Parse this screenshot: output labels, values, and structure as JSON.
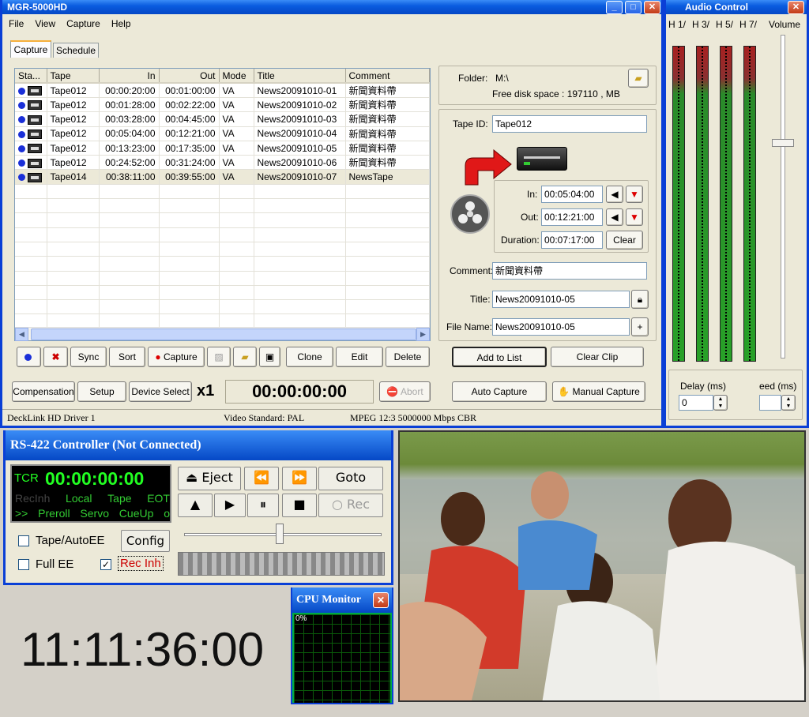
{
  "main_window": {
    "title": "MGR-5000HD",
    "menu": [
      "File",
      "View",
      "Capture",
      "Help"
    ],
    "tabs": [
      "Capture",
      "Schedule"
    ],
    "columns": [
      "Sta...",
      "Tape",
      "In",
      "Out",
      "Mode",
      "Title",
      "Comment"
    ],
    "rows": [
      {
        "tape": "Tape012",
        "in": "00:00:20:00",
        "out": "00:01:00:00",
        "mode": "VA",
        "title": "News20091010-01",
        "comment": "新聞資料帶"
      },
      {
        "tape": "Tape012",
        "in": "00:01:28:00",
        "out": "00:02:22:00",
        "mode": "VA",
        "title": "News20091010-02",
        "comment": "新聞資料帶"
      },
      {
        "tape": "Tape012",
        "in": "00:03:28:00",
        "out": "00:04:45:00",
        "mode": "VA",
        "title": "News20091010-03",
        "comment": "新聞資料帶"
      },
      {
        "tape": "Tape012",
        "in": "00:05:04:00",
        "out": "00:12:21:00",
        "mode": "VA",
        "title": "News20091010-04",
        "comment": "新聞資料帶"
      },
      {
        "tape": "Tape012",
        "in": "00:13:23:00",
        "out": "00:17:35:00",
        "mode": "VA",
        "title": "News20091010-05",
        "comment": "新聞資料帶"
      },
      {
        "tape": "Tape012",
        "in": "00:24:52:00",
        "out": "00:31:24:00",
        "mode": "VA",
        "title": "News20091010-06",
        "comment": "新聞資料帶"
      },
      {
        "tape": "Tape014",
        "in": "00:38:11:00",
        "out": "00:39:55:00",
        "mode": "VA",
        "title": "News20091010-07",
        "comment": "NewsTape"
      }
    ],
    "toolbar": {
      "sync": "Sync",
      "sort": "Sort",
      "capture": "Capture",
      "clone": "Clone",
      "edit": "Edit",
      "delete": "Delete"
    },
    "bottom": {
      "compensation": "Compensation",
      "setup": "Setup",
      "device_select": "Device Select",
      "speed": "x1",
      "timecode": "00:00:00:00",
      "abort": "Abort",
      "auto_capture": "Auto Capture",
      "manual_capture": "Manual Capture"
    },
    "folder": {
      "label": "Folder:",
      "value": "M:\\",
      "free": "Free disk space : 197110 , MB"
    },
    "clip": {
      "tape_id_label": "Tape ID:",
      "tape_id": "Tape012",
      "in_label": "In:",
      "in": "00:05:04:00",
      "out_label": "Out:",
      "out": "00:12:21:00",
      "duration_label": "Duration:",
      "duration": "00:07:17:00",
      "clear": "Clear",
      "comment_label": "Comment:",
      "comment": "新聞資料帶",
      "title_label": "Title:",
      "title": "News20091010-05",
      "filename_label": "File Name:",
      "filename": "News20091010-05",
      "add": "Add to List",
      "clear_clip": "Clear Clip"
    },
    "status": {
      "driver": "DeckLink HD Driver 1",
      "standard": "Video Standard: PAL",
      "codec": "MPEG 12:3 5000000 Mbps CBR"
    }
  },
  "audio": {
    "title": "Audio Control",
    "channels": [
      "H 1/",
      "H 3/",
      "H 5/",
      "H 7/"
    ],
    "volume_label": "Volume",
    "delay_label": "Delay (ms)",
    "delay_value": "0",
    "speed_label": "eed (ms)",
    "speed_value": ""
  },
  "rs422": {
    "title": "RS-422 Controller (Not Connected)",
    "tcr": "TCR",
    "timecode": "00:00:00:00",
    "row1": [
      "RecInh",
      "Local",
      "Tape",
      "EOT"
    ],
    "row2": [
      ">>",
      "Preroll",
      "Servo",
      "CueUp",
      "o"
    ],
    "eject": "Eject",
    "goto": "Goto",
    "rec": "Rec",
    "tape_autoee": "Tape/AutoEE",
    "config": "Config",
    "full_ee": "Full EE",
    "rec_inh": "Rec Inh"
  },
  "clock": "11:11:36:00",
  "cpu": {
    "title": "CPU Monitor",
    "percent": "0%"
  }
}
